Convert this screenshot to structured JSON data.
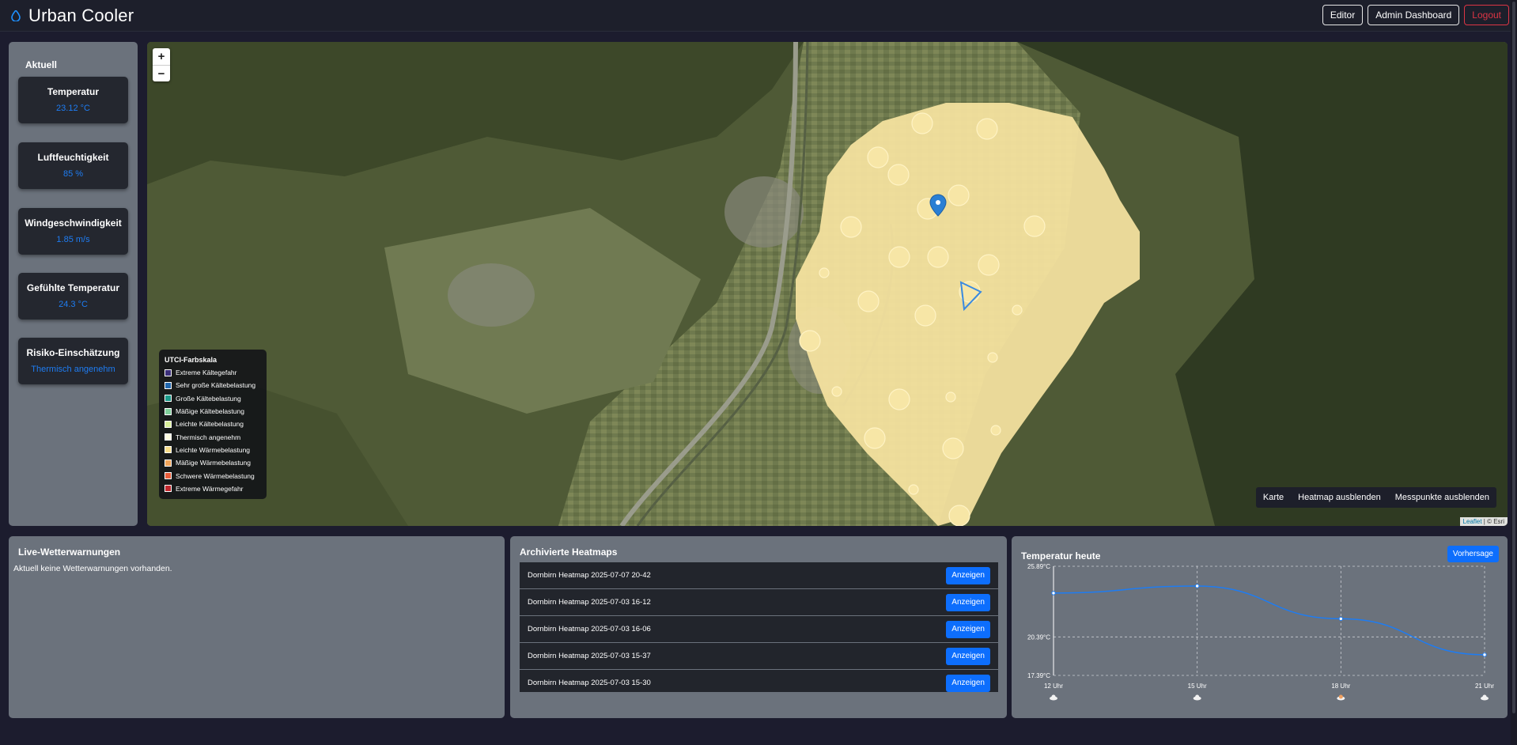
{
  "header": {
    "title": "Urban Cooler",
    "nav": [
      "Editor",
      "Admin Dashboard",
      "Logout"
    ]
  },
  "sidebar": {
    "title": "Aktuell",
    "cards": [
      {
        "label": "Temperatur",
        "value": "23.12 °C"
      },
      {
        "label": "Luftfeuchtigkeit",
        "value": "85 %"
      },
      {
        "label": "Windgeschwindigkeit",
        "value": "1.85 m/s"
      },
      {
        "label": "Gefühlte Temperatur",
        "value": "24.3 °C"
      },
      {
        "label": "Risiko-Einschätzung",
        "value": "Thermisch angenehm"
      }
    ]
  },
  "map": {
    "zoom_in": "+",
    "zoom_out": "−",
    "legend_title": "UTCI-Farbskala",
    "legend": [
      {
        "label": "Extreme Kältegefahr",
        "color": "#3b2f7a"
      },
      {
        "label": "Sehr große Kältebelastung",
        "color": "#2166ac"
      },
      {
        "label": "Große Kältebelastung",
        "color": "#1a9a8a"
      },
      {
        "label": "Mäßige Kältebelastung",
        "color": "#7fcf9a"
      },
      {
        "label": "Leichte Kältebelastung",
        "color": "#d8ef9a"
      },
      {
        "label": "Thermisch angenehm",
        "color": "#fdfde0"
      },
      {
        "label": "Leichte Wärmebelastung",
        "color": "#f7dc8a"
      },
      {
        "label": "Mäßige Wärmebelastung",
        "color": "#f2a55a"
      },
      {
        "label": "Schwere Wärmebelastung",
        "color": "#e85d3a"
      },
      {
        "label": "Extreme Wärmegefahr",
        "color": "#c1272d"
      }
    ],
    "layers": [
      "Karte",
      "Heatmap ausblenden",
      "Messpunkte ausblenden"
    ],
    "attribution": {
      "leaflet": "Leaflet",
      "rest": " | © Esri"
    },
    "heat_color": "#f6e3a0"
  },
  "warnings": {
    "title": "Live-Wetterwarnungen",
    "text": "Aktuell keine Wetterwarnungen vorhanden."
  },
  "archive": {
    "title": "Archivierte Heatmaps",
    "button_label": "Anzeigen",
    "items": [
      "Dornbirn Heatmap 2025-07-07 20-42",
      "Dornbirn Heatmap 2025-07-03 16-12",
      "Dornbirn Heatmap 2025-07-03 16-06",
      "Dornbirn Heatmap 2025-07-03 15-37",
      "Dornbirn Heatmap 2025-07-03 15-30"
    ]
  },
  "temperature_chart": {
    "title": "Temperatur heute",
    "button": "Vorhersage",
    "weather_icons": [
      "cloud-icon",
      "cloud-icon",
      "cloud-sun-icon",
      "cloud-icon"
    ]
  },
  "chart_data": {
    "type": "line",
    "title": "Temperatur heute",
    "categories": [
      "12 Uhr",
      "15 Uhr",
      "18 Uhr",
      "21 Uhr"
    ],
    "values": [
      23.8,
      24.35,
      21.8,
      19.0
    ],
    "y_ticks": [
      "25.89°C",
      "20.39°C",
      "17.39°C"
    ],
    "ylim": [
      17.39,
      25.89
    ],
    "color": "#1e7cf2",
    "grid": true
  }
}
